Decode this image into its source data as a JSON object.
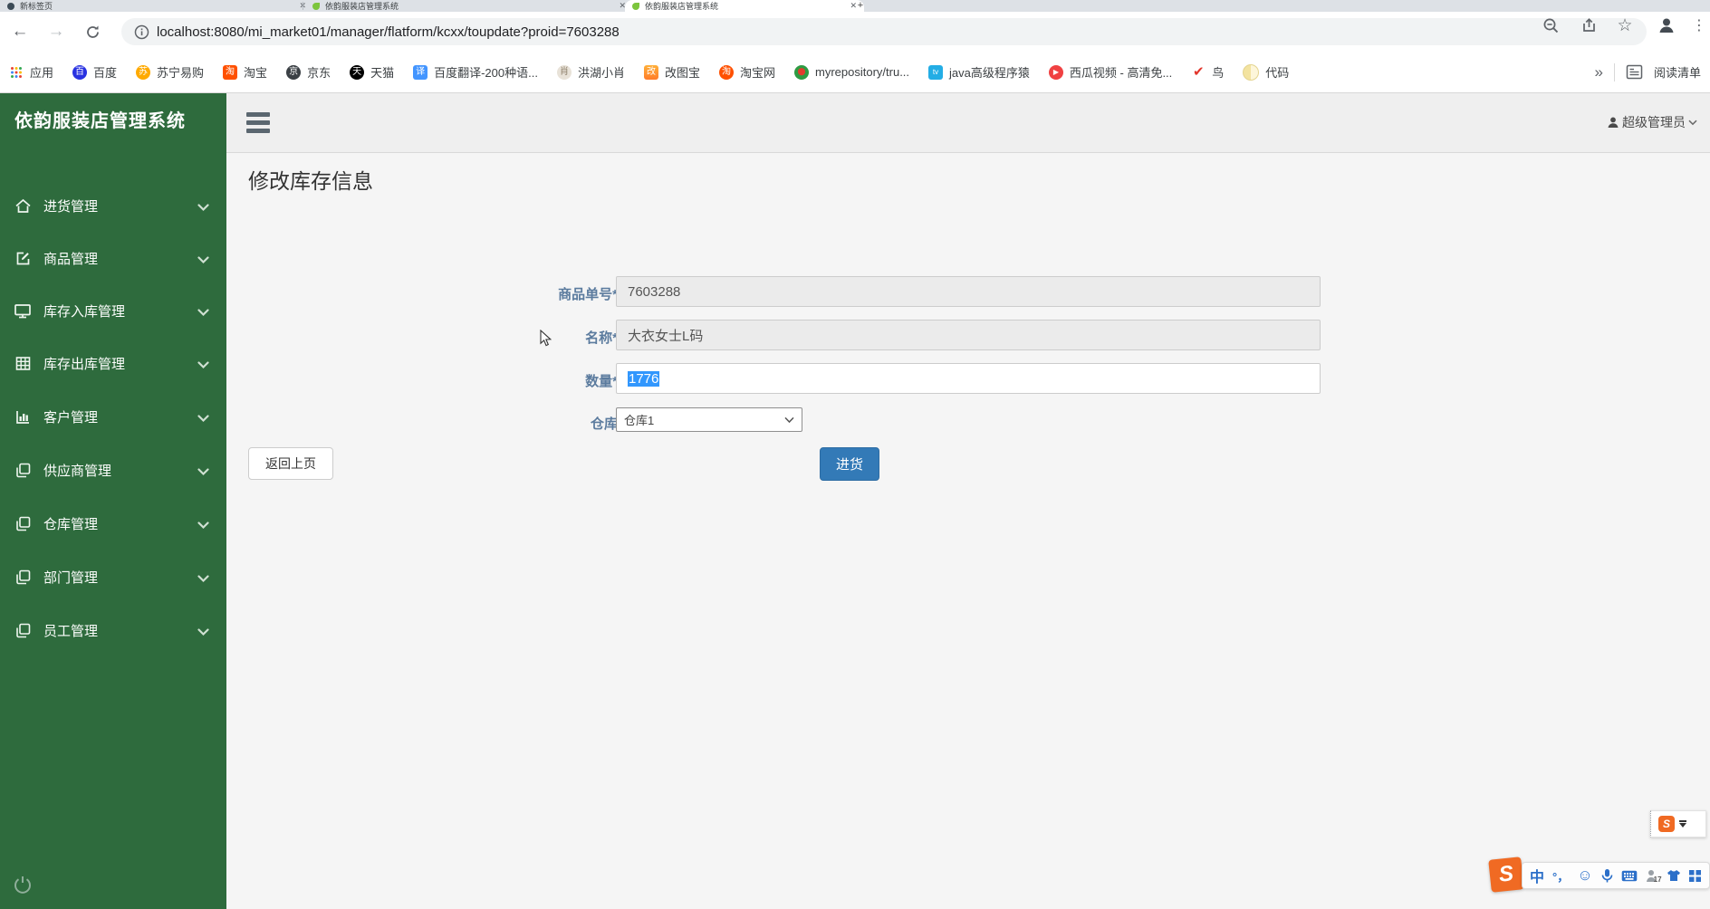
{
  "colors": {
    "sidebar_green": "#2e6b3d",
    "primary_blue": "#337ab7",
    "selection_blue": "#3297fd",
    "label_blue": "#5b7b9e",
    "ime_orange": "#f06a23"
  },
  "browser": {
    "tabs": [
      {
        "title": "新标签页"
      },
      {
        "title": "依韵服装店管理系统"
      },
      {
        "title": "依韵服装店管理系统"
      }
    ],
    "new_tab_button": "+",
    "nav": {
      "url": "localhost:8080/mi_market01/manager/flatform/kcxx/toupdate?proid=7603288"
    },
    "bookmarks": [
      {
        "label": "应用"
      },
      {
        "label": "百度",
        "glyph": "百",
        "icon_style": "background:#2932e1;border-radius:50%"
      },
      {
        "label": "苏宁易购",
        "glyph": "苏",
        "icon_style": "background:#ffaa00;border-radius:50%"
      },
      {
        "label": "淘宝",
        "glyph": "淘",
        "icon_style": "background:#ff5000"
      },
      {
        "label": "京东",
        "glyph": "京",
        "icon_style": "background:#3b4045;border-radius:50%"
      },
      {
        "label": "天猫",
        "glyph": "天",
        "icon_style": "background:#000;border-radius:50%"
      },
      {
        "label": "百度翻译-200种语...",
        "glyph": "译",
        "icon_style": "background:#4395ff"
      },
      {
        "label": "洪湖小肖",
        "glyph": "肖",
        "icon_style": "background:#e8e2d8;color:#8d7f6a;border-radius:50%"
      },
      {
        "label": "改图宝",
        "glyph": "改",
        "icon_style": "background:linear-gradient(#ffb03a,#ff7c2a)"
      },
      {
        "label": "淘宝网",
        "glyph": "淘",
        "icon_style": "background:#ff5000;border-radius:50%"
      },
      {
        "label": "myrepository/tru...",
        "glyph": "",
        "icon_style": "background:radial-gradient(circle at 50% 45%,#e23b2e 0 32%,#2e9b43 36%);border-radius:50%"
      },
      {
        "label": "java高级程序猿",
        "glyph": "tv",
        "icon_style": "background:#23ade5;font-size:8px"
      },
      {
        "label": "西瓜视频 - 高清免...",
        "glyph": "▶",
        "icon_style": "background:#f04142;border-radius:50%;font-size:8px"
      },
      {
        "label": "鸟",
        "glyph": "✔",
        "icon_style": "background:transparent;color:#e2352b;font-size:15px"
      },
      {
        "label": "代码",
        "glyph": "",
        "icon_style": "background:linear-gradient(90deg,#f3e3a0 50%,#fdf6da 50%);border-radius:50%;border:1px solid #e4d48f"
      }
    ],
    "bookmarks_overflow": "»",
    "reading_list": "阅读清单"
  },
  "sidebar": {
    "title": "依韵服装店管理系统",
    "items": [
      {
        "label": "进货管理"
      },
      {
        "label": "商品管理"
      },
      {
        "label": "库存入库管理"
      },
      {
        "label": "库存出库管理"
      },
      {
        "label": "客户管理"
      },
      {
        "label": "供应商管理"
      },
      {
        "label": "仓库管理"
      },
      {
        "label": "部门管理"
      },
      {
        "label": "员工管理"
      }
    ]
  },
  "header": {
    "user": "超级管理员"
  },
  "main": {
    "page_title": "修改库存信息",
    "form": {
      "product_id": {
        "label": "商品单号*",
        "value": "7603288"
      },
      "name": {
        "label": "名称*",
        "value": "大衣女士L码"
      },
      "quantity": {
        "label": "数量*",
        "value": "1776"
      },
      "warehouse": {
        "label": "仓库",
        "value": "仓库1"
      }
    },
    "back_button": "返回上页",
    "submit_button": "进货"
  },
  "ime": {
    "brand": "S",
    "mode": "中",
    "punct": "°，",
    "user_count": "17"
  }
}
